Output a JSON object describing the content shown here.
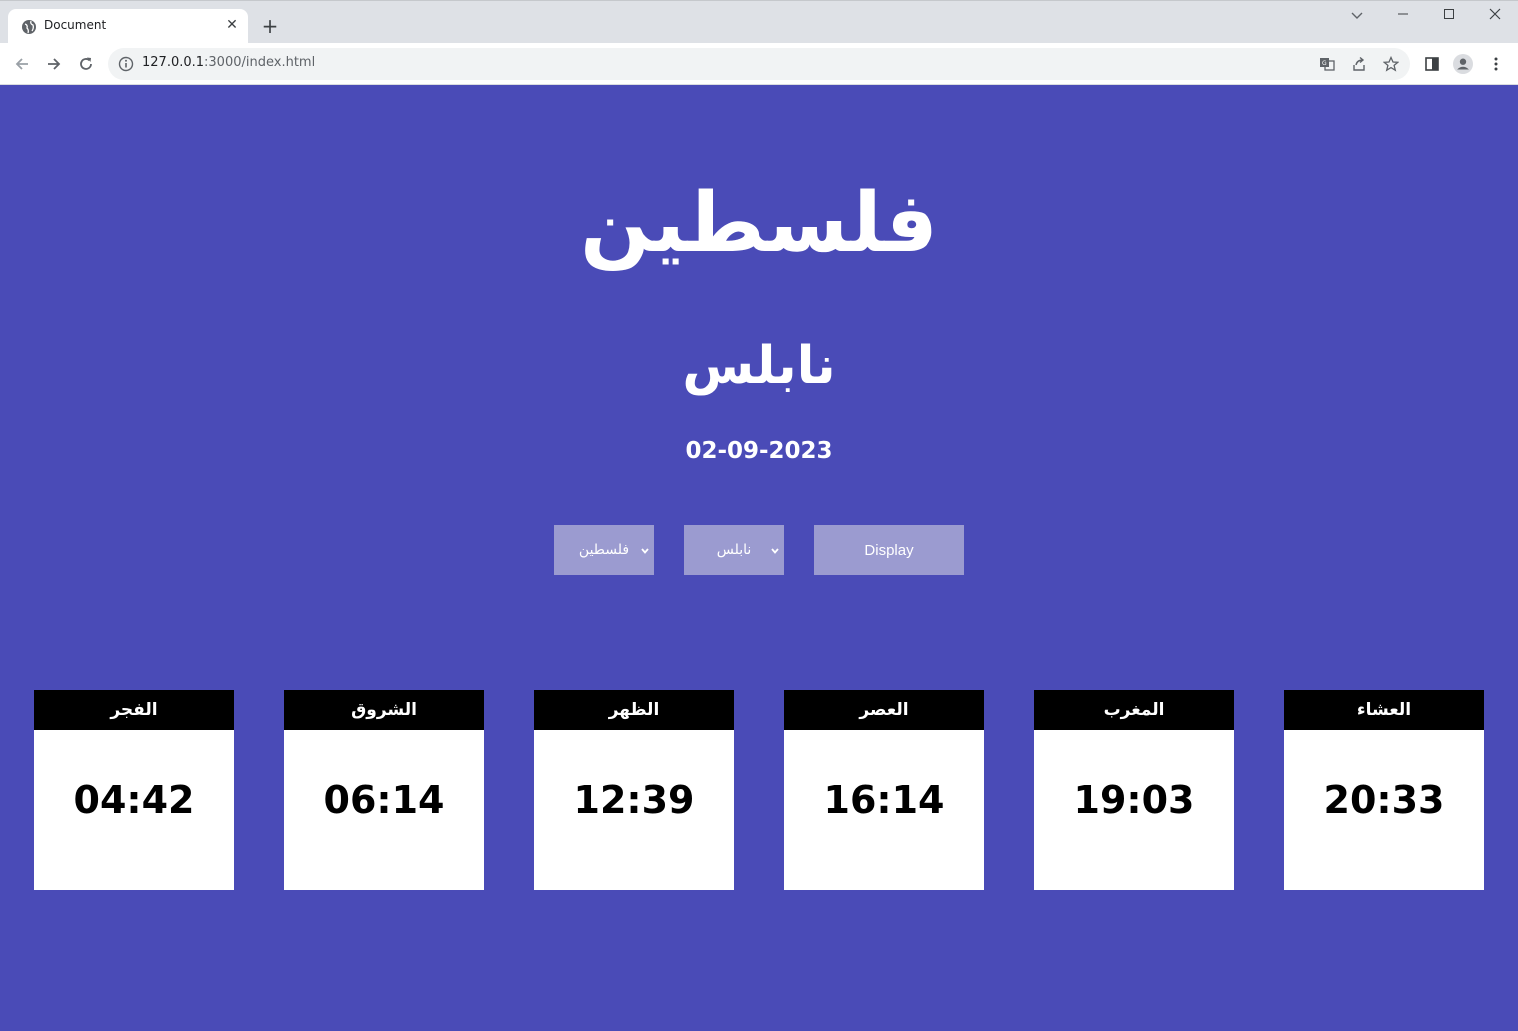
{
  "browser": {
    "tab_title": "Document",
    "url_host": "127.0.0.1",
    "url_path": ":3000/index.html"
  },
  "page": {
    "country": "فلسطين",
    "city": "نابلس",
    "date": "02-09-2023",
    "country_select_value": "فلسطين",
    "city_select_value": "نابلس",
    "display_label": "Display"
  },
  "prayers": [
    {
      "name": "الفجر",
      "time": "04:42"
    },
    {
      "name": "الشروق",
      "time": "06:14"
    },
    {
      "name": "الظهر",
      "time": "12:39"
    },
    {
      "name": "العصر",
      "time": "16:14"
    },
    {
      "name": "المغرب",
      "time": "19:03"
    },
    {
      "name": "العشاء",
      "time": "20:33"
    }
  ],
  "colors": {
    "background": "#4a4bb7",
    "control": "#9b9bd0",
    "card_header": "#000000",
    "card_body": "#ffffff"
  }
}
